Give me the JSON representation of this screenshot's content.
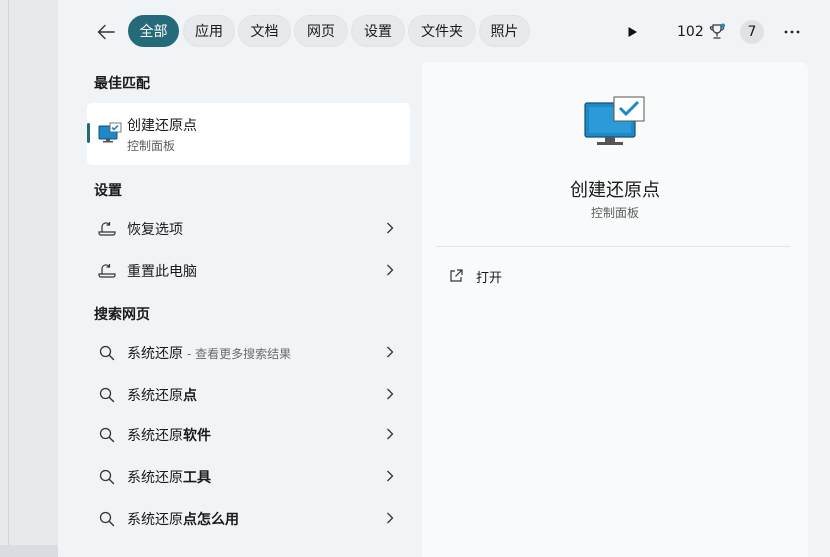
{
  "tabs": [
    {
      "label": "全部",
      "active": true
    },
    {
      "label": "应用"
    },
    {
      "label": "文档"
    },
    {
      "label": "网页"
    },
    {
      "label": "设置"
    },
    {
      "label": "文件夹"
    },
    {
      "label": "照片"
    }
  ],
  "header": {
    "points": "102",
    "badge": "7"
  },
  "sections": {
    "best_match": "最佳匹配",
    "settings": "设置",
    "web": "搜索网页"
  },
  "best_match": {
    "title": "创建还原点",
    "subtitle": "控制面板"
  },
  "settings_items": [
    {
      "label": "恢复选项"
    },
    {
      "label": "重置此电脑"
    }
  ],
  "web_items": [
    {
      "query": "系统还原",
      "suffix": "",
      "hint": "- 查看更多搜索结果"
    },
    {
      "query": "系统还原",
      "suffix": "点",
      "hint": ""
    },
    {
      "query": "系统还原",
      "suffix": "软件",
      "hint": ""
    },
    {
      "query": "系统还原",
      "suffix": "工具",
      "hint": ""
    },
    {
      "query": "系统还原",
      "suffix": "点怎么用",
      "hint": ""
    }
  ],
  "detail": {
    "title": "创建还原点",
    "subtitle": "控制面板",
    "open_label": "打开"
  },
  "colors": {
    "accent": "#256a78",
    "icon_blue": "#1e88c8"
  }
}
